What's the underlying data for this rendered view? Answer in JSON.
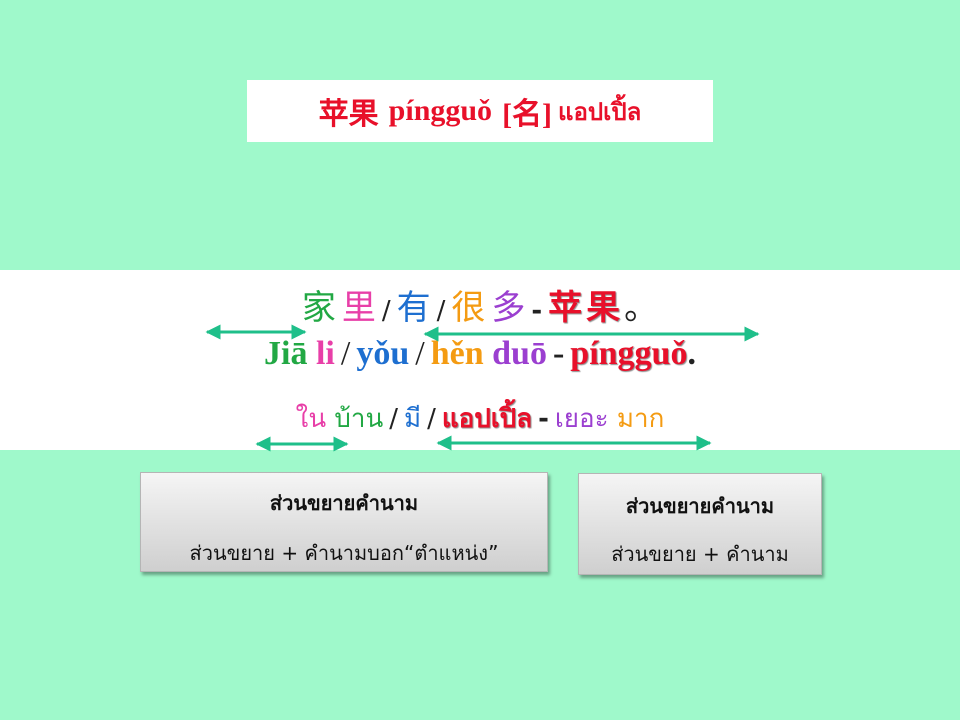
{
  "title": {
    "hanzi": "苹果",
    "pinyin": "píngguǒ",
    "pos": "[名]",
    "thai": "แอปเปิ้ล"
  },
  "sentence": {
    "hanzi": [
      {
        "text": "家",
        "color": "#22a844"
      },
      {
        "text": "里",
        "color": "#e83fa8"
      },
      {
        "text": "/",
        "color": "#222222"
      },
      {
        "text": "有",
        "color": "#1e6fd0"
      },
      {
        "text": "/",
        "color": "#222222"
      },
      {
        "text": "很",
        "color": "#f49b12"
      },
      {
        "text": "多",
        "color": "#9b3fd0"
      },
      {
        "text": "-",
        "color": "#222222"
      },
      {
        "text": "苹果",
        "color": "#e8102a"
      },
      {
        "text": "。",
        "color": "#222222"
      }
    ],
    "pinyin": [
      {
        "text": "Jiā",
        "color": "#22a844"
      },
      {
        "text": "li",
        "color": "#e83fa8"
      },
      {
        "text": "/",
        "color": "#222222"
      },
      {
        "text": "yǒu",
        "color": "#1e6fd0"
      },
      {
        "text": "/",
        "color": "#222222"
      },
      {
        "text": "hěn",
        "color": "#f49b12"
      },
      {
        "text": "duō",
        "color": "#9b3fd0"
      },
      {
        "text": "-",
        "color": "#222222"
      },
      {
        "text": "píngguǒ",
        "color": "#e8102a"
      },
      {
        "text": ".",
        "color": "#222222"
      }
    ],
    "thai": [
      {
        "text": "ใน",
        "color": "#e83fa8"
      },
      {
        "text": "บ้าน",
        "color": "#22a844"
      },
      {
        "text": "/",
        "color": "#222222"
      },
      {
        "text": "มี",
        "color": "#1e6fd0"
      },
      {
        "text": "/",
        "color": "#222222"
      },
      {
        "text": "แอปเปิ้ล",
        "color": "#e8102a"
      },
      {
        "text": "-",
        "color": "#222222"
      },
      {
        "text": "เยอะ",
        "color": "#9b3fd0"
      },
      {
        "text": "มาก",
        "color": "#f49b12"
      }
    ]
  },
  "boxes": [
    {
      "title": "ส่วนขยายคำนาม",
      "body": "ส่วนขยาย + คำนามบอก“ตำแหน่ง”"
    },
    {
      "title": "ส่วนขยายคำนาม",
      "body": "ส่วนขยาย + คำนาม"
    }
  ],
  "colors": {
    "background": "#9ff9cb",
    "arrow": "#1fbf8a",
    "accent_red": "#e8102a"
  }
}
